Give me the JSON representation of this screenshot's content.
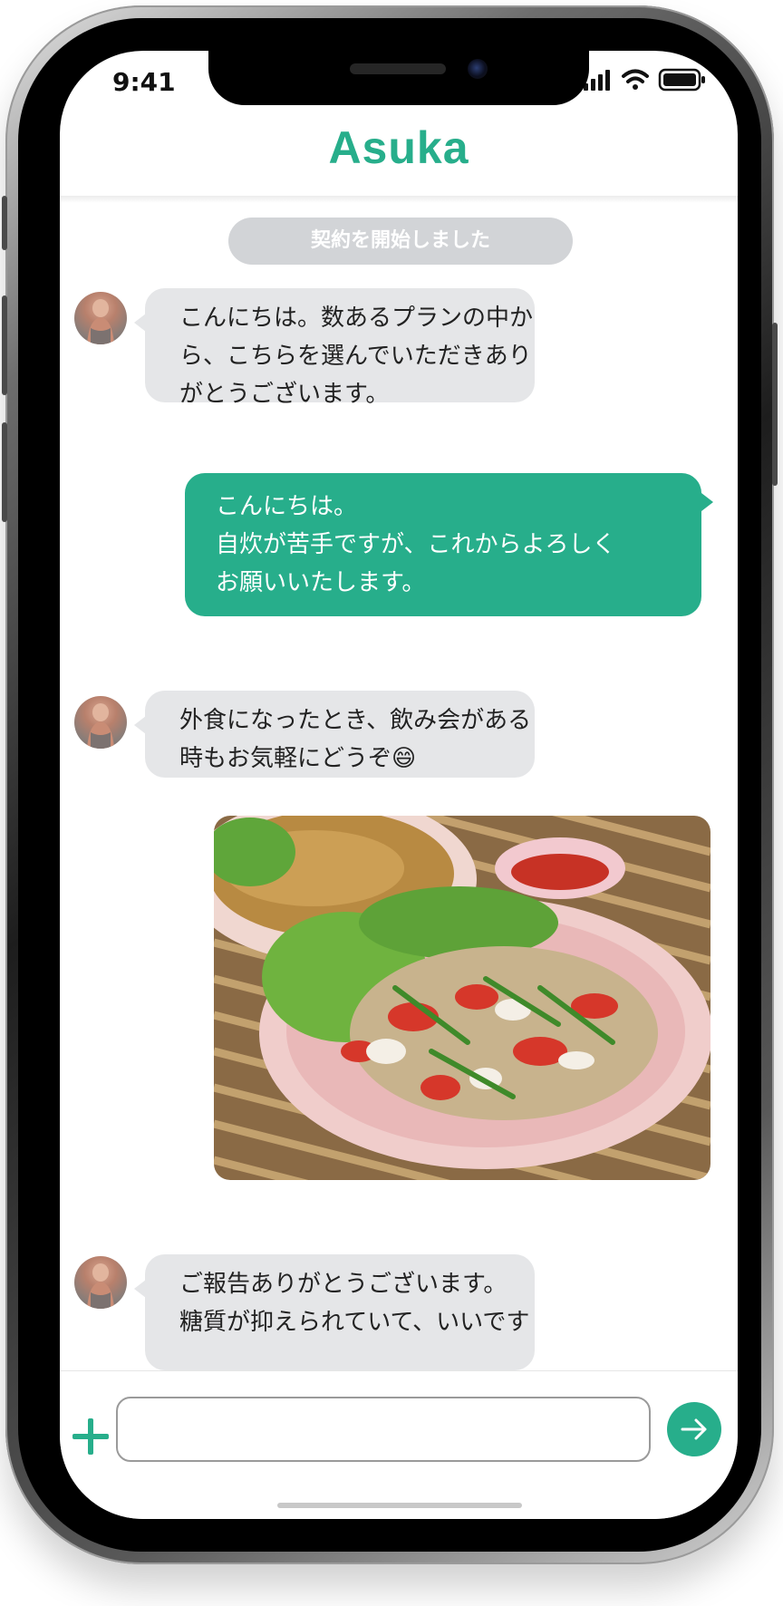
{
  "status_bar": {
    "time": "9:41"
  },
  "header": {
    "title": "Asuka"
  },
  "system_message": "契約を開始しました",
  "messages": [
    {
      "sender": "trainer",
      "lines": [
        "こんにちは。数あるプランの中か",
        "ら、こちらを選んでいただきあり",
        "がとうございます。"
      ]
    },
    {
      "sender": "user",
      "lines": [
        "こんにちは。",
        "自炊が苦手ですが、これからよろしく",
        "お願いいたします。"
      ]
    },
    {
      "sender": "trainer",
      "lines": [
        "外食になったとき、飲み会がある",
        "時もお気軽にどうぞ😄"
      ]
    },
    {
      "sender": "user",
      "type": "photo",
      "icon": "food-photo"
    },
    {
      "sender": "trainer",
      "lines": [
        "ご報告ありがとうございます。",
        "糖質が抑えられていて、いいです"
      ]
    }
  ],
  "composer": {
    "value": "",
    "placeholder": ""
  },
  "colors": {
    "accent": "#27ae8b",
    "incoming_bubble": "#e5e6e8",
    "system_pill": "#d2d4d7"
  },
  "icons": {
    "attach": "plus-icon",
    "send": "arrow-right-icon"
  }
}
